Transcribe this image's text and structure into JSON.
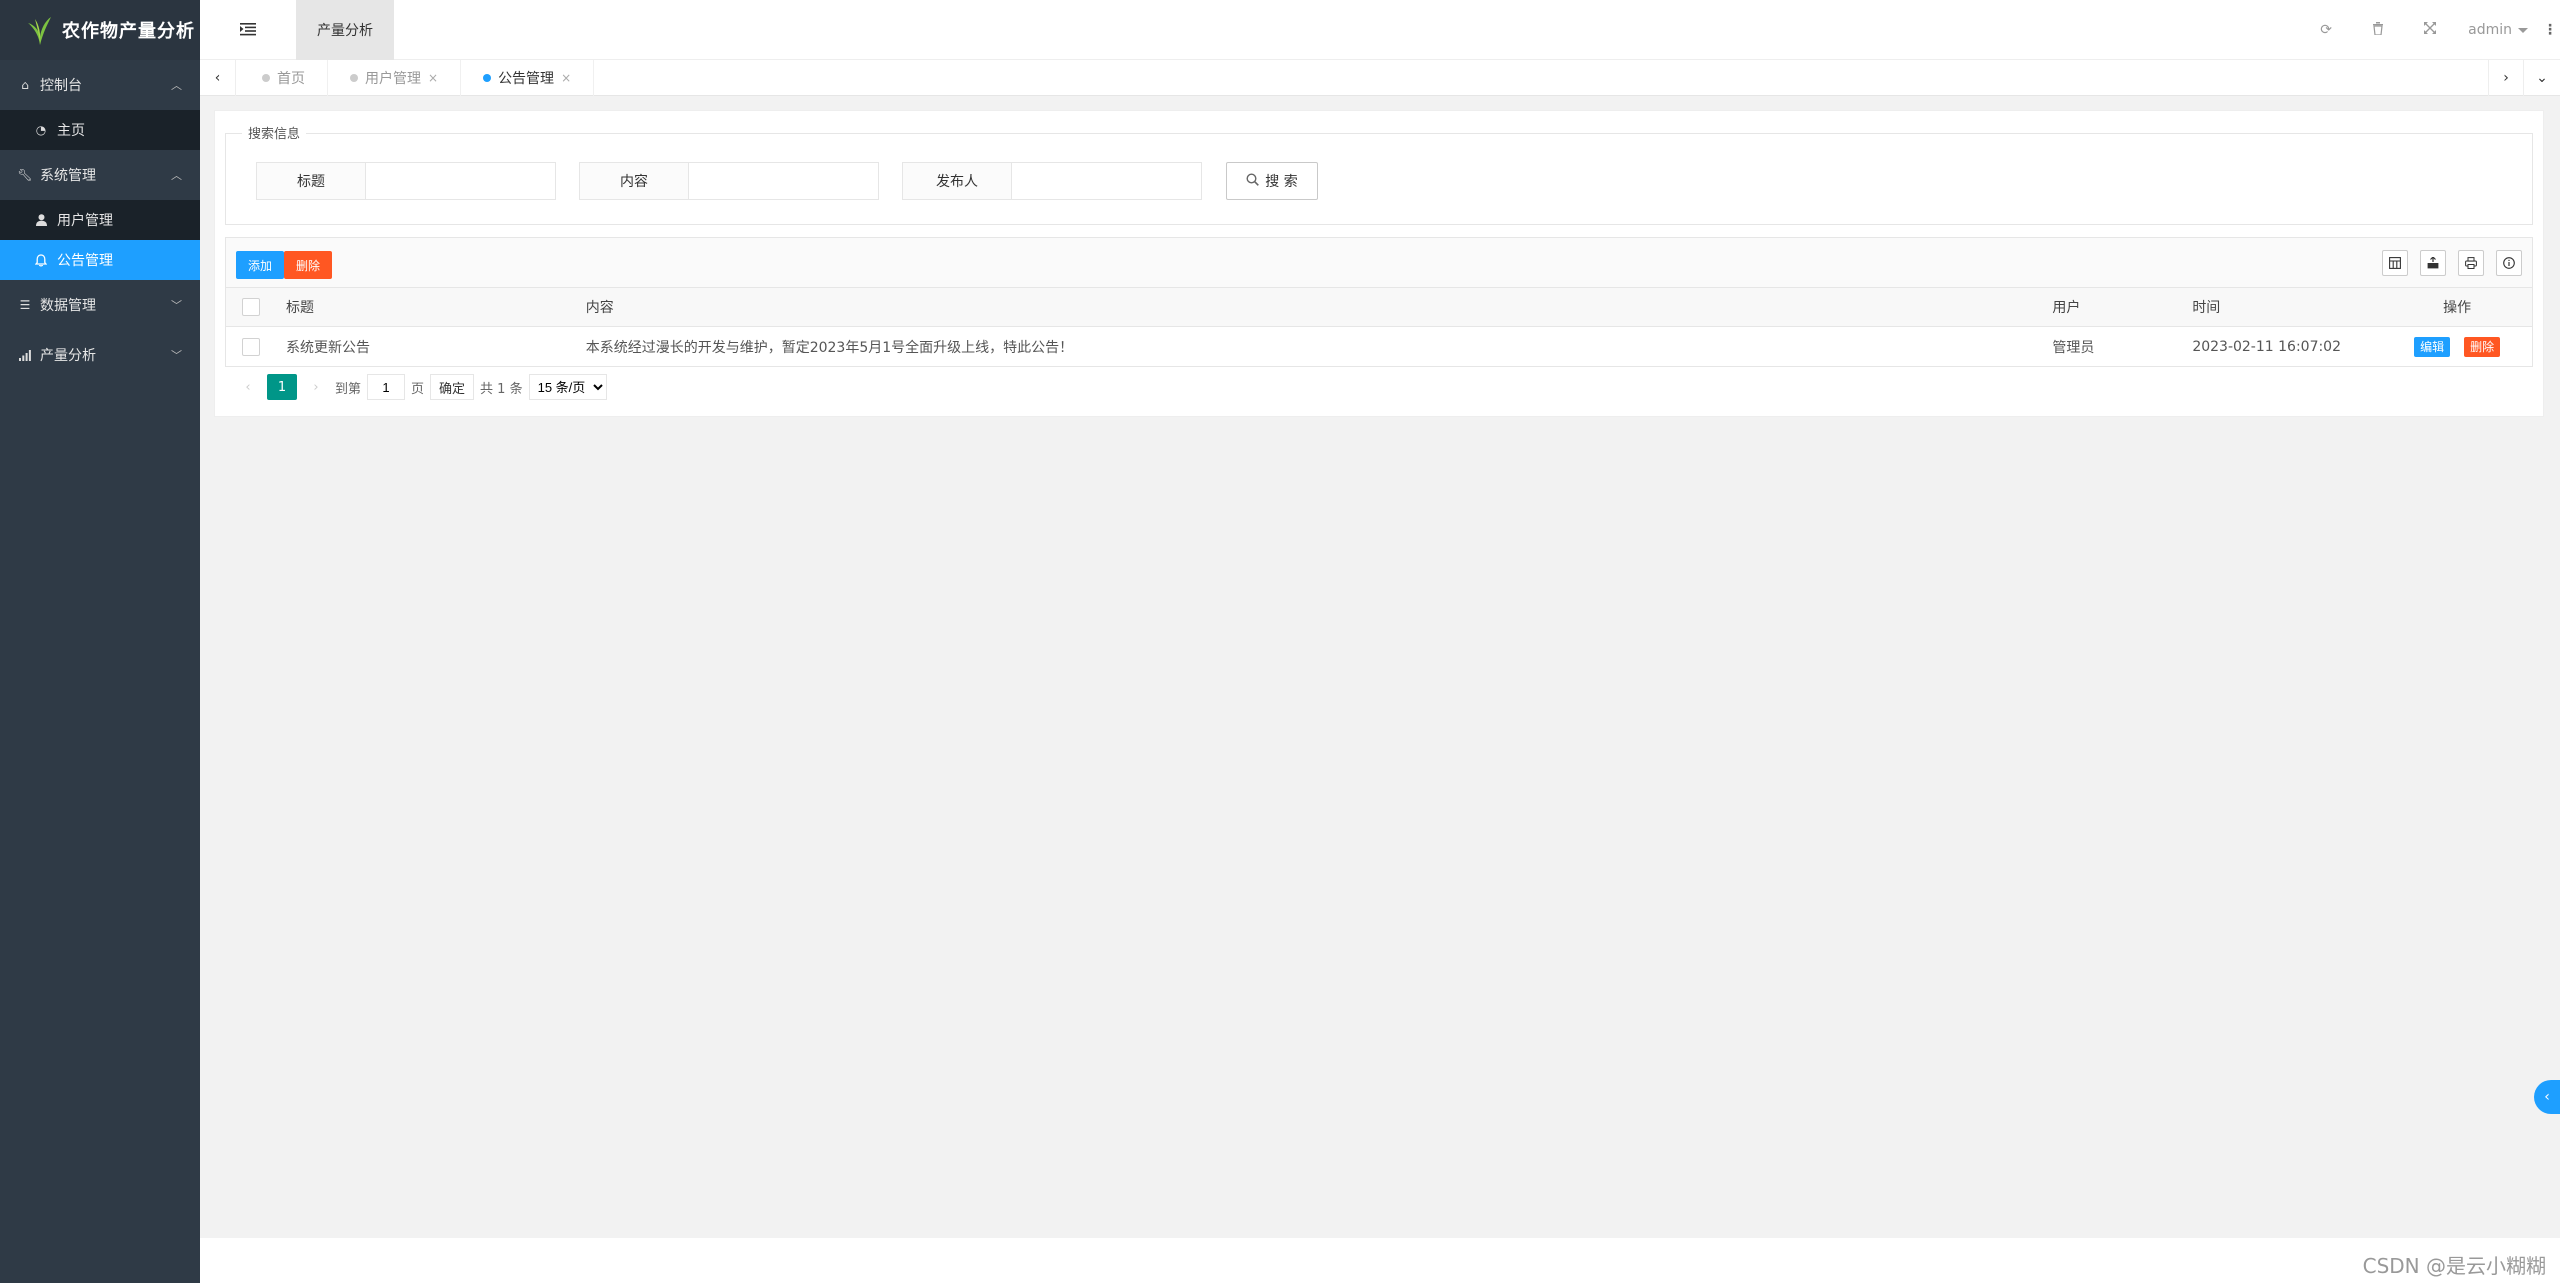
{
  "app": {
    "title": "农作物产量分析"
  },
  "sidebar": {
    "groups": [
      {
        "label": "控制台",
        "icon": "home-icon",
        "expanded": true,
        "items": [
          {
            "label": "主页",
            "icon": "dashboard-icon"
          }
        ]
      },
      {
        "label": "系统管理",
        "icon": "wrench-icon",
        "expanded": true,
        "items": [
          {
            "label": "用户管理",
            "icon": "user-icon"
          },
          {
            "label": "公告管理",
            "icon": "bell-icon",
            "active": true
          }
        ]
      },
      {
        "label": "数据管理",
        "icon": "list-icon",
        "expanded": false,
        "items": []
      },
      {
        "label": "产量分析",
        "icon": "bar-chart-icon",
        "expanded": false,
        "items": []
      }
    ]
  },
  "header": {
    "module_tab": "产量分析",
    "user": "admin",
    "icons": [
      "refresh-icon",
      "trash-icon",
      "fullscreen-icon"
    ]
  },
  "tabbar": {
    "tabs": [
      {
        "label": "首页",
        "closable": false
      },
      {
        "label": "用户管理",
        "closable": true
      },
      {
        "label": "公告管理",
        "closable": true,
        "active": true
      }
    ],
    "close_glyph": "×"
  },
  "search": {
    "legend": "搜索信息",
    "fields": [
      {
        "label": "标题",
        "value": ""
      },
      {
        "label": "内容",
        "value": ""
      },
      {
        "label": "发布人",
        "value": ""
      }
    ],
    "button": "搜 索"
  },
  "toolbar": {
    "add": "添加",
    "delete": "删除",
    "tools": [
      "columns-icon",
      "export-icon",
      "print-icon",
      "info-icon"
    ]
  },
  "table": {
    "columns": [
      "标题",
      "内容",
      "用户",
      "时间",
      "操作"
    ],
    "rows": [
      {
        "title": "系统更新公告",
        "content": "本系统经过漫长的开发与维护，暂定2023年5月1号全面升级上线，特此公告！",
        "user": "管理员",
        "time": "2023-02-11 16:07:02",
        "edit": "编辑",
        "delete": "删除"
      }
    ]
  },
  "pager": {
    "current": "1",
    "goto_prefix": "到第",
    "goto_value": "1",
    "goto_suffix": "页",
    "confirm": "确定",
    "total": "共 1 条",
    "page_size": "15 条/页"
  },
  "footer": {
    "watermark": "CSDN @是云小糊糊"
  },
  "colors": {
    "sidebar": "#2f3a46",
    "accent": "#1e9fff",
    "danger": "#ff5722",
    "pager": "#009688"
  }
}
